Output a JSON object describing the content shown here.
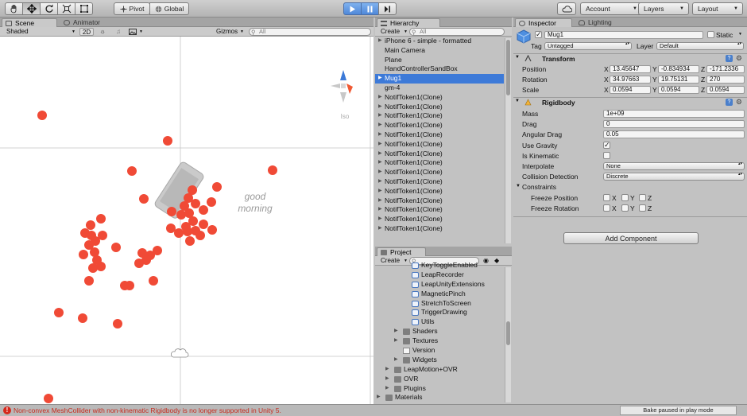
{
  "toolbar": {
    "tools": [
      "hand-icon",
      "move-icon",
      "rotate-icon",
      "scale-icon",
      "rect-icon"
    ],
    "pivot_label": "Pivot",
    "global_label": "Global",
    "cloud_icon": "cloud-icon",
    "account_label": "Account",
    "layers_label": "Layers",
    "layout_label": "Layout"
  },
  "scene": {
    "tab_scene": "Scene",
    "tab_animator": "Animator",
    "shading_mode": "Shaded",
    "mode_2d": "2D",
    "gizmos_label": "Gizmos",
    "search_placeholder": "All",
    "overlay_text_line1": "good",
    "overlay_text_line2": "morning",
    "gizmo_label": "Iso",
    "accent_red": "#f04a36"
  },
  "hierarchy": {
    "tab_label": "Hierarchy",
    "create_label": "Create",
    "search_placeholder": "All",
    "items": [
      {
        "label": "iPhone 6 - simple - formatted",
        "expandable": true,
        "selected": false
      },
      {
        "label": "Main Camera",
        "expandable": false,
        "selected": false
      },
      {
        "label": "Plane",
        "expandable": false,
        "selected": false
      },
      {
        "label": "HandControllerSandBox",
        "expandable": false,
        "selected": false
      },
      {
        "label": "Mug1",
        "expandable": true,
        "selected": true
      },
      {
        "label": "gm-4",
        "expandable": false,
        "selected": false
      },
      {
        "label": "NotifToken1(Clone)",
        "expandable": true,
        "selected": false
      },
      {
        "label": "NotifToken1(Clone)",
        "expandable": true,
        "selected": false
      },
      {
        "label": "NotifToken1(Clone)",
        "expandable": true,
        "selected": false
      },
      {
        "label": "NotifToken1(Clone)",
        "expandable": true,
        "selected": false
      },
      {
        "label": "NotifToken1(Clone)",
        "expandable": true,
        "selected": false
      },
      {
        "label": "NotifToken1(Clone)",
        "expandable": true,
        "selected": false
      },
      {
        "label": "NotifToken1(Clone)",
        "expandable": true,
        "selected": false
      },
      {
        "label": "NotifToken1(Clone)",
        "expandable": true,
        "selected": false
      },
      {
        "label": "NotifToken1(Clone)",
        "expandable": true,
        "selected": false
      },
      {
        "label": "NotifToken1(Clone)",
        "expandable": true,
        "selected": false
      },
      {
        "label": "NotifToken1(Clone)",
        "expandable": true,
        "selected": false
      },
      {
        "label": "NotifToken1(Clone)",
        "expandable": true,
        "selected": false
      },
      {
        "label": "NotifToken1(Clone)",
        "expandable": true,
        "selected": false
      },
      {
        "label": "NotifToken1(Clone)",
        "expandable": true,
        "selected": false
      },
      {
        "label": "NotifToken1(Clone)",
        "expandable": true,
        "selected": false
      }
    ]
  },
  "project": {
    "tab_label": "Project",
    "create_label": "Create",
    "items": [
      {
        "label": "KeyToggleEnabled",
        "icon": "cs",
        "indent": 2
      },
      {
        "label": "LeapRecorder",
        "icon": "cs",
        "indent": 2
      },
      {
        "label": "LeapUnityExtensions",
        "icon": "cs",
        "indent": 2
      },
      {
        "label": "MagneticPinch",
        "icon": "cs",
        "indent": 2
      },
      {
        "label": "StretchToScreen",
        "icon": "cs",
        "indent": 2
      },
      {
        "label": "TriggerDrawing",
        "icon": "cs",
        "indent": 2
      },
      {
        "label": "Utils",
        "icon": "cs",
        "indent": 2
      },
      {
        "label": "Shaders",
        "icon": "folder",
        "indent": 1,
        "expandable": true
      },
      {
        "label": "Textures",
        "icon": "folder",
        "indent": 1,
        "expandable": true
      },
      {
        "label": "Version",
        "icon": "file",
        "indent": 1
      },
      {
        "label": "Widgets",
        "icon": "folder",
        "indent": 1,
        "expandable": true
      },
      {
        "label": "LeapMotion+OVR",
        "icon": "folder",
        "indent": 0,
        "expandable": true
      },
      {
        "label": "OVR",
        "icon": "folder",
        "indent": 0,
        "expandable": true
      },
      {
        "label": "Plugins",
        "icon": "folder",
        "indent": 0,
        "expandable": true
      },
      {
        "label": "Materials",
        "icon": "folder",
        "indent": -1,
        "expandable": true
      }
    ]
  },
  "inspector": {
    "tab_inspector": "Inspector",
    "tab_lighting": "Lighting",
    "object_name": "Mug1",
    "active": true,
    "static_label": "Static",
    "tag_label": "Tag",
    "tag_value": "Untagged",
    "layer_label": "Layer",
    "layer_value": "Default",
    "transform": {
      "title": "Transform",
      "position_label": "Position",
      "rotation_label": "Rotation",
      "scale_label": "Scale",
      "position": {
        "x": "13.45647",
        "y": "-0.834934",
        "z": "-171.2336"
      },
      "rotation": {
        "x": "34.97663",
        "y": "19.75131",
        "z": "270"
      },
      "scale": {
        "x": "0.0594",
        "y": "0.0594",
        "z": "0.0594"
      },
      "axis_x": "X",
      "axis_y": "Y",
      "axis_z": "Z"
    },
    "rigidbody": {
      "title": "Rigidbody",
      "mass_label": "Mass",
      "mass": "1e+09",
      "drag_label": "Drag",
      "drag": "0",
      "angular_drag_label": "Angular Drag",
      "angular_drag": "0.05",
      "use_gravity_label": "Use Gravity",
      "use_gravity": true,
      "is_kinematic_label": "Is Kinematic",
      "is_kinematic": false,
      "interpolate_label": "Interpolate",
      "interpolate": "None",
      "collision_label": "Collision Detection",
      "collision": "Discrete",
      "constraints_label": "Constraints",
      "freeze_position_label": "Freeze Position",
      "freeze_rotation_label": "Freeze Rotation",
      "axis_x": "X",
      "axis_y": "Y",
      "axis_z": "Z"
    },
    "add_component_label": "Add Component"
  },
  "status": {
    "error_text": "Non-convex MeshCollider with non-kinematic Rigidbody is no longer supported in Unity 5.",
    "bake_text": "Bake paused in play mode"
  }
}
